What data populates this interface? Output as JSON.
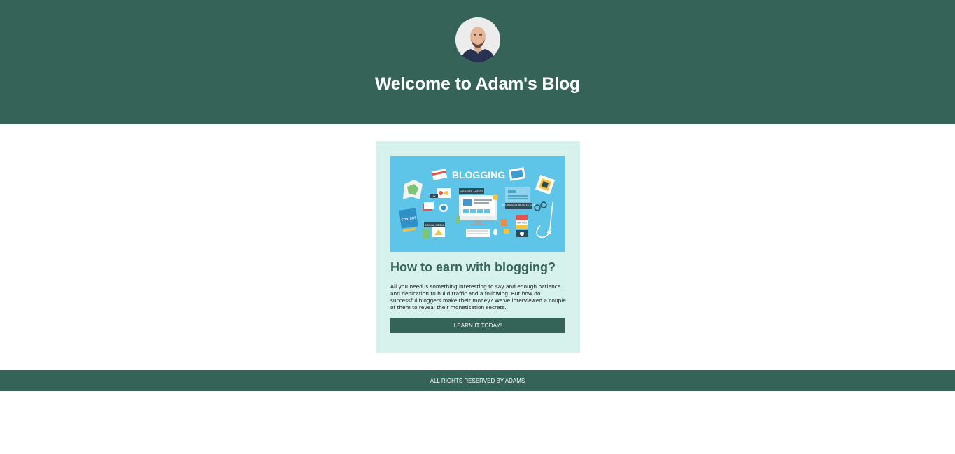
{
  "header": {
    "title": "Welcome to Adam's Blog",
    "avatar": "author-avatar",
    "background": "#356357"
  },
  "card": {
    "image_title": "BLOGGING",
    "image_labels": {
      "website_audits": "WEBSITE AUDITS",
      "ux": "UX",
      "content": "CONTENT",
      "social_media": "SOCIAL MEDIA",
      "information_architecture": "INFORMATION ARCHITECTURE",
      "writing": "WRITING"
    },
    "title": "How to earn with blogging?",
    "text": "All you need is something interesting to say and enough patience and dedication to build traffic and a following. But how do successful bloggers make their money? We've interviewed a couple of them to reveal their monetisation secrets.",
    "button_label": "LEARN IT TODAY!",
    "background": "#d7f1ec"
  },
  "footer": {
    "text": "ALL RIGHTS RESERVED BY ADAMS"
  }
}
